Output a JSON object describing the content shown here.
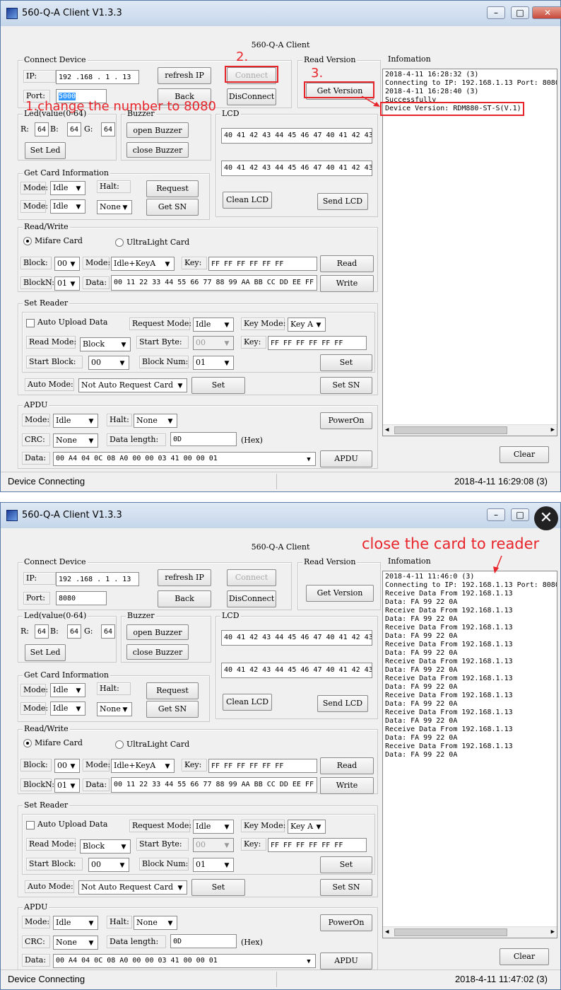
{
  "colors": {
    "annotation": "#e8252b",
    "titlebar": "#c5d6ea",
    "client_bg": "#f0f0f0"
  },
  "windows": [
    {
      "title": "560-Q-A Client V1.3.3",
      "center_title": "560-Q-A Client",
      "connect": {
        "group": "Connect Device",
        "ip_label": "IP:",
        "ip_value": "192 .168 .  1  . 13",
        "port_label": "Port:",
        "port_value": "5000",
        "refresh_ip": "refresh IP",
        "connect": "Connect",
        "back": "Back",
        "disconnect": "DisConnect"
      },
      "read_version": {
        "group": "Read Version",
        "get_version": "Get Version"
      },
      "info": {
        "group": "Infomation",
        "clear": "Clear",
        "lines": [
          "2018-4-11  16:28:32 (3)",
          "Connecting to IP: 192.168.1.13 Port: 8080",
          "2018-4-11  16:28:40 (3)",
          "Successfully",
          "Device Version: RDM880-ST-S(V.1)"
        ]
      },
      "led": {
        "group": "Led(value(0-64)",
        "r_label": "R:",
        "r": "64",
        "b_label": "B:",
        "b": "64",
        "g_label": "G:",
        "g": "64",
        "set_led": "Set Led"
      },
      "buzzer": {
        "group": "Buzzer",
        "open": "open Buzzer",
        "close": "close Buzzer"
      },
      "lcd": {
        "group": "LCD",
        "line1": "40 41 42 43 44 45 46 47 40 41 42 43",
        "line2": "40 41 42 43 44 45 46 47 40 41 42 43",
        "clean": "Clean LCD",
        "send": "Send LCD"
      },
      "getcard": {
        "group": "Get Card Information",
        "mode_label": "Mode:",
        "mode1": "Idle",
        "mode2": "Idle",
        "halt_label": "Halt:",
        "halt": "None",
        "request": "Request",
        "get_sn": "Get SN"
      },
      "rw": {
        "group": "Read/Write",
        "mifare": "Mifare Card",
        "ultralight": "UltraLight Card",
        "block_label": "Block:",
        "block": "00",
        "mode_label": "Mode:",
        "mode": "Idle+KeyA",
        "key_label": "Key:",
        "key": "FF FF FF FF FF FF",
        "read": "Read",
        "blockn_label": "BlockN:",
        "blockn": "01",
        "data_label": "Data:",
        "data": "00 11 22 33 44 55 66 77 88 99 AA BB CC DD EE FF",
        "write": "Write"
      },
      "setreader": {
        "group": "Set Reader",
        "auto_upload": "Auto Upload Data",
        "request_mode_label": "Request Mode:",
        "request_mode": "Idle",
        "key_mode_label": "Key Mode:",
        "key_mode": "Key A",
        "read_mode_label": "Read Mode:",
        "read_mode": "Block",
        "start_byte_label": "Start Byte:",
        "start_byte": "00",
        "key_label": "Key:",
        "key": "FF FF FF FF FF FF",
        "start_block_label": "Start Block:",
        "start_block": "00",
        "block_num_label": "Block Num:",
        "block_num": "01",
        "set": "Set",
        "auto_mode_label": "Auto Mode:",
        "auto_mode": "Not Auto Request Card",
        "set2": "Set",
        "set_sn": "Set SN"
      },
      "apdu": {
        "group": "APDU",
        "mode_label": "Mode:",
        "mode": "Idle",
        "halt_label": "Halt:",
        "halt": "None",
        "power_on": "PowerOn",
        "crc_label": "CRC:",
        "crc": "None",
        "datalen_label": "Data length:",
        "datalen": "0D",
        "hex": "(Hex)",
        "data_label": "Data:",
        "data": "00 A4 04 0C 08 A0 00 00 03 41 00 00 01",
        "apdu": "APDU"
      },
      "status": {
        "left": "Device Connecting",
        "right": "2018-4-11  16:29:08 (3)"
      },
      "annotations": {
        "a1": "1.change the number to 8080",
        "a2": "2.",
        "a3": "3."
      }
    },
    {
      "title": "560-Q-A Client V1.3.3",
      "center_title": "560-Q-A Client",
      "connect": {
        "group": "Connect Device",
        "ip_label": "IP:",
        "ip_value": "192 .168 .  1  . 13",
        "port_label": "Port:",
        "port_value": "8080",
        "refresh_ip": "refresh IP",
        "connect": "Connect",
        "back": "Back",
        "disconnect": "DisConnect"
      },
      "read_version": {
        "group": "Read Version",
        "get_version": "Get Version"
      },
      "info": {
        "group": "Infomation",
        "clear": "Clear",
        "lines": [
          "2018-4-11  11:46:0 (3)",
          "Connecting to IP: 192.168.1.13 Port: 8080",
          "Receive Data From 192.168.1.13",
          "Data: FA 99 22 0A",
          "Receive Data From 192.168.1.13",
          "Data: FA 99 22 0A",
          "Receive Data From 192.168.1.13",
          "Data: FA 99 22 0A",
          "Receive Data From 192.168.1.13",
          "Data: FA 99 22 0A",
          "Receive Data From 192.168.1.13",
          "Data: FA 99 22 0A",
          "Receive Data From 192.168.1.13",
          "Data: FA 99 22 0A",
          "Receive Data From 192.168.1.13",
          "Data: FA 99 22 0A",
          "Receive Data From 192.168.1.13",
          "Data: FA 99 22 0A",
          "Receive Data From 192.168.1.13",
          "Data: FA 99 22 0A",
          "Receive Data From 192.168.1.13",
          "Data: FA 99 22 0A"
        ]
      },
      "led": {
        "group": "Led(value(0-64)",
        "r_label": "R:",
        "r": "64",
        "b_label": "B:",
        "b": "64",
        "g_label": "G:",
        "g": "64",
        "set_led": "Set Led"
      },
      "buzzer": {
        "group": "Buzzer",
        "open": "open Buzzer",
        "close": "close Buzzer"
      },
      "lcd": {
        "group": "LCD",
        "line1": "40 41 42 43 44 45 46 47 40 41 42 43",
        "line2": "40 41 42 43 44 45 46 47 40 41 42 43",
        "clean": "Clean LCD",
        "send": "Send LCD"
      },
      "getcard": {
        "group": "Get Card Information",
        "mode_label": "Mode:",
        "mode1": "Idle",
        "mode2": "Idle",
        "halt_label": "Halt:",
        "halt": "None",
        "request": "Request",
        "get_sn": "Get SN"
      },
      "rw": {
        "group": "Read/Write",
        "mifare": "Mifare Card",
        "ultralight": "UltraLight Card",
        "block_label": "Block:",
        "block": "00",
        "mode_label": "Mode:",
        "mode": "Idle+KeyA",
        "key_label": "Key:",
        "key": "FF FF FF FF FF FF",
        "read": "Read",
        "blockn_label": "BlockN:",
        "blockn": "01",
        "data_label": "Data:",
        "data": "00 11 22 33 44 55 66 77 88 99 AA BB CC DD EE FF",
        "write": "Write"
      },
      "setreader": {
        "group": "Set Reader",
        "auto_upload": "Auto Upload Data",
        "request_mode_label": "Request Mode:",
        "request_mode": "Idle",
        "key_mode_label": "Key Mode:",
        "key_mode": "Key A",
        "read_mode_label": "Read Mode:",
        "read_mode": "Block",
        "start_byte_label": "Start Byte:",
        "start_byte": "00",
        "key_label": "Key:",
        "key": "FF FF FF FF FF FF",
        "start_block_label": "Start Block:",
        "start_block": "00",
        "block_num_label": "Block Num:",
        "block_num": "01",
        "set": "Set",
        "auto_mode_label": "Auto Mode:",
        "auto_mode": "Not Auto Request Card",
        "set2": "Set",
        "set_sn": "Set SN"
      },
      "apdu": {
        "group": "APDU",
        "mode_label": "Mode:",
        "mode": "Idle",
        "halt_label": "Halt:",
        "halt": "None",
        "power_on": "PowerOn",
        "crc_label": "CRC:",
        "crc": "None",
        "datalen_label": "Data length:",
        "datalen": "0D",
        "hex": "(Hex)",
        "data_label": "Data:",
        "data": "00 A4 04 0C 08 A0 00 00 03 41 00 00 01",
        "apdu": "APDU"
      },
      "status": {
        "left": "Device Connecting",
        "right": "2018-4-11  11:47:02 (3)"
      },
      "annotations": {
        "a4": "close the card to reader"
      }
    }
  ]
}
